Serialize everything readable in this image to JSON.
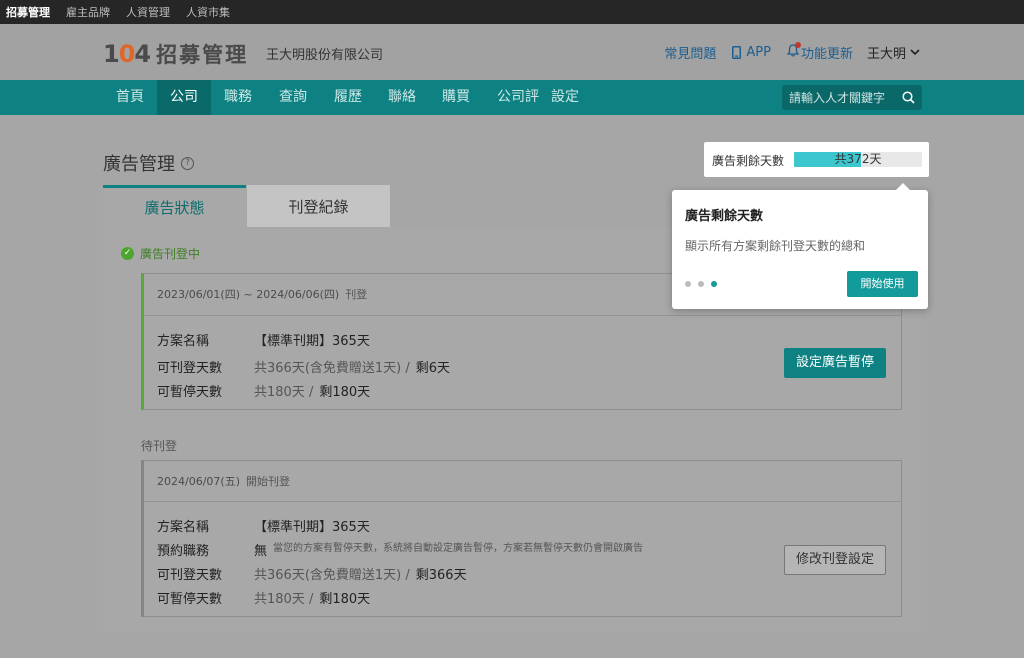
{
  "topbar": {
    "items": [
      "招募管理",
      "雇主品牌",
      "人資管理",
      "人資市集"
    ]
  },
  "header": {
    "logo_num": "104",
    "logo_text": "招募管理",
    "company": "王大明股份有限公司",
    "links": {
      "faq": "常見問題",
      "app": "APP",
      "updates": "功能更新",
      "user": "王大明"
    }
  },
  "nav": {
    "items": [
      "首頁",
      "公司",
      "職務",
      "查詢",
      "履歷",
      "聯絡",
      "購買",
      "公司評",
      "設定"
    ],
    "active": "公司",
    "search_placeholder": "請輸入人才關鍵字"
  },
  "page": {
    "title": "廣告管理",
    "days_label": "廣告剩餘天數",
    "days_bar_text": "共372天",
    "days_fill_ratio": 0.52
  },
  "tabs": {
    "status": "廣告狀態",
    "history": "刊登紀錄"
  },
  "status_label": "廣告刊登中",
  "active_ad": {
    "period": "2023/06/01(四) ~ 2024/06/06(四)",
    "period_tag": "刊登",
    "plan_key": "方案名稱",
    "plan_value": "【標準刊期】365天",
    "days_key": "可刊登天數",
    "days_total": "共366天(含免費贈送1天) /",
    "days_remain": "剩6天",
    "pause_key": "可暫停天數",
    "pause_total": "共180天 /",
    "pause_remain": "剩180天",
    "button": "設定廣告暫停"
  },
  "pending_label": "待刊登",
  "pending_ad": {
    "date": "2024/06/07(五)",
    "date_tag": "開始刊登",
    "plan_key": "方案名稱",
    "plan_value": "【標準刊期】365天",
    "reserve_key": "預約職務",
    "reserve_value": "無",
    "reserve_note": "當您的方案有暫停天數，系統將自動設定廣告暫停，方案若無暫停天數仍會開啟廣告",
    "days_key": "可刊登天數",
    "days_total": "共366天(含免費贈送1天) /",
    "days_remain": "剩366天",
    "pause_key": "可暫停天數",
    "pause_total": "共180天 /",
    "pause_remain": "剩180天",
    "button": "修改刊登設定"
  },
  "popover": {
    "title": "廣告剩餘天數",
    "desc": "顯示所有方案剩餘刊登天數的總和",
    "button": "開始使用",
    "step_active": 3,
    "steps": 3
  },
  "colors": {
    "teal": "#0e8282",
    "accent": "#3cc7cf",
    "green": "#4ca52f",
    "logo_orange": "#e0672a"
  }
}
